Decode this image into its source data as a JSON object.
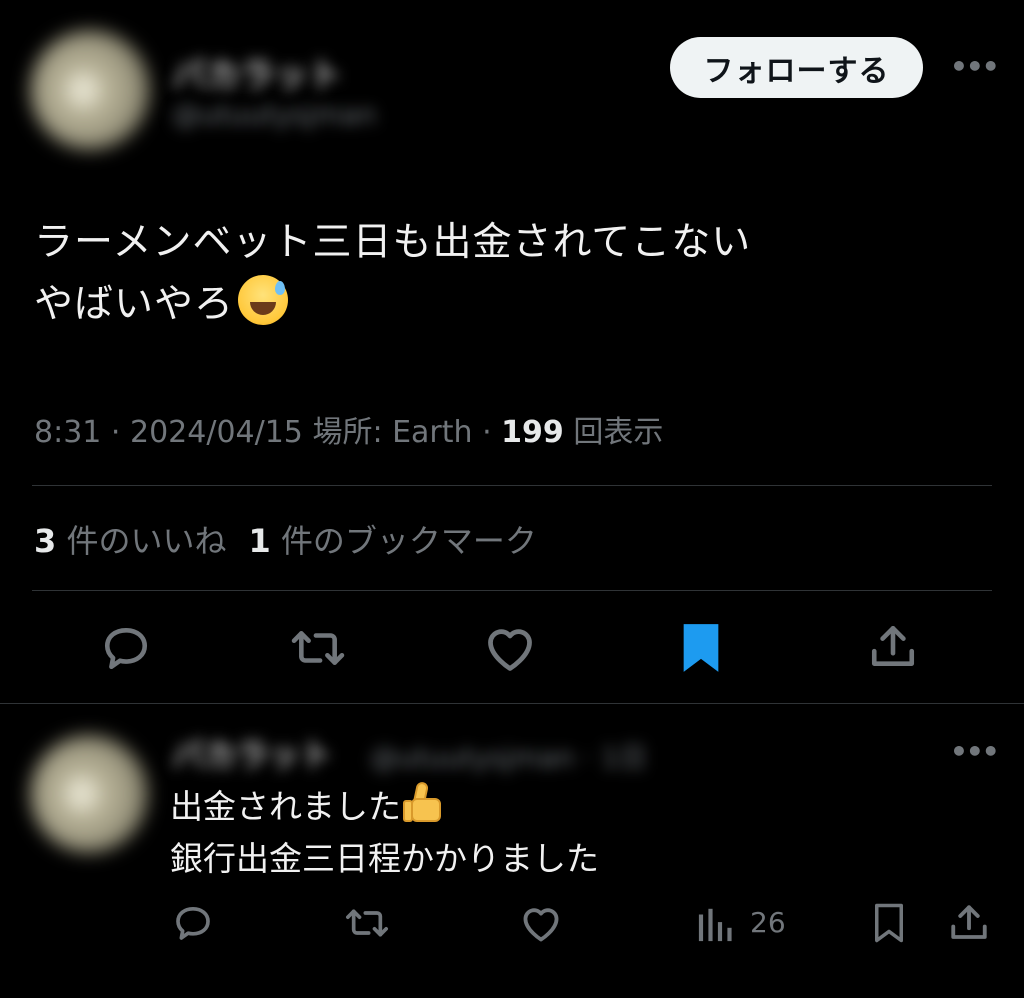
{
  "tweet": {
    "author_name": "バカラット",
    "author_handle": "@utuutysjman",
    "follow_label": "フォローする",
    "more_label": "•••",
    "text_line1": "ラーメンベット三日も出金されてこない",
    "text_line2": "やばいやろ",
    "time": "8:31",
    "sep1": " · ",
    "date": "2024/04/15",
    "location_label": " 場所: ",
    "location": "Earth",
    "sep2": " · ",
    "views_count": "199",
    "views_label": " 回表示",
    "likes_count": "3",
    "likes_label": " 件のいいね",
    "bookmarks_count": "1",
    "bookmarks_label": " 件のブックマーク",
    "actions": {
      "reply": "reply-icon",
      "retweet": "retweet-icon",
      "like": "heart-icon",
      "bookmark": "bookmark-icon",
      "share": "share-icon"
    },
    "bookmark_color": "#1d9bf0"
  },
  "reply": {
    "author_name": "バカラット",
    "author_handle": "@utuutysjman · 1日",
    "more_label": "•••",
    "text_line1": "出金されました",
    "text_line2": "銀行出金三日程かかりました",
    "views_count": "26"
  },
  "colors": {
    "background": "#000000",
    "text": "#e7e9ea",
    "muted": "#71767b",
    "divider": "#2f3336"
  }
}
